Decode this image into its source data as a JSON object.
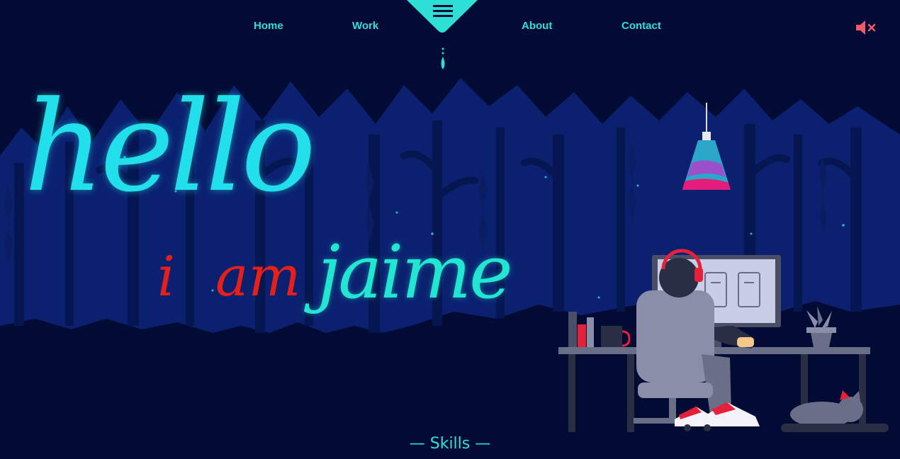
{
  "nav": {
    "home": "Home",
    "work": "Work",
    "about": "About",
    "contact": "Contact"
  },
  "hero": {
    "hello": "hello",
    "i": "i",
    "am": "am",
    "name": "jaime"
  },
  "skills": {
    "label": "— Skills —"
  },
  "icons": {
    "menu": "hamburger-menu-icon",
    "mute": "speaker-muted-icon",
    "scroll": "scroll-drop-icon"
  },
  "colors": {
    "background": "#020b33",
    "accent": "#2de0d6",
    "hello": "#21e0ec",
    "iam": "#e5201b",
    "mute": "#ef5a6a"
  }
}
